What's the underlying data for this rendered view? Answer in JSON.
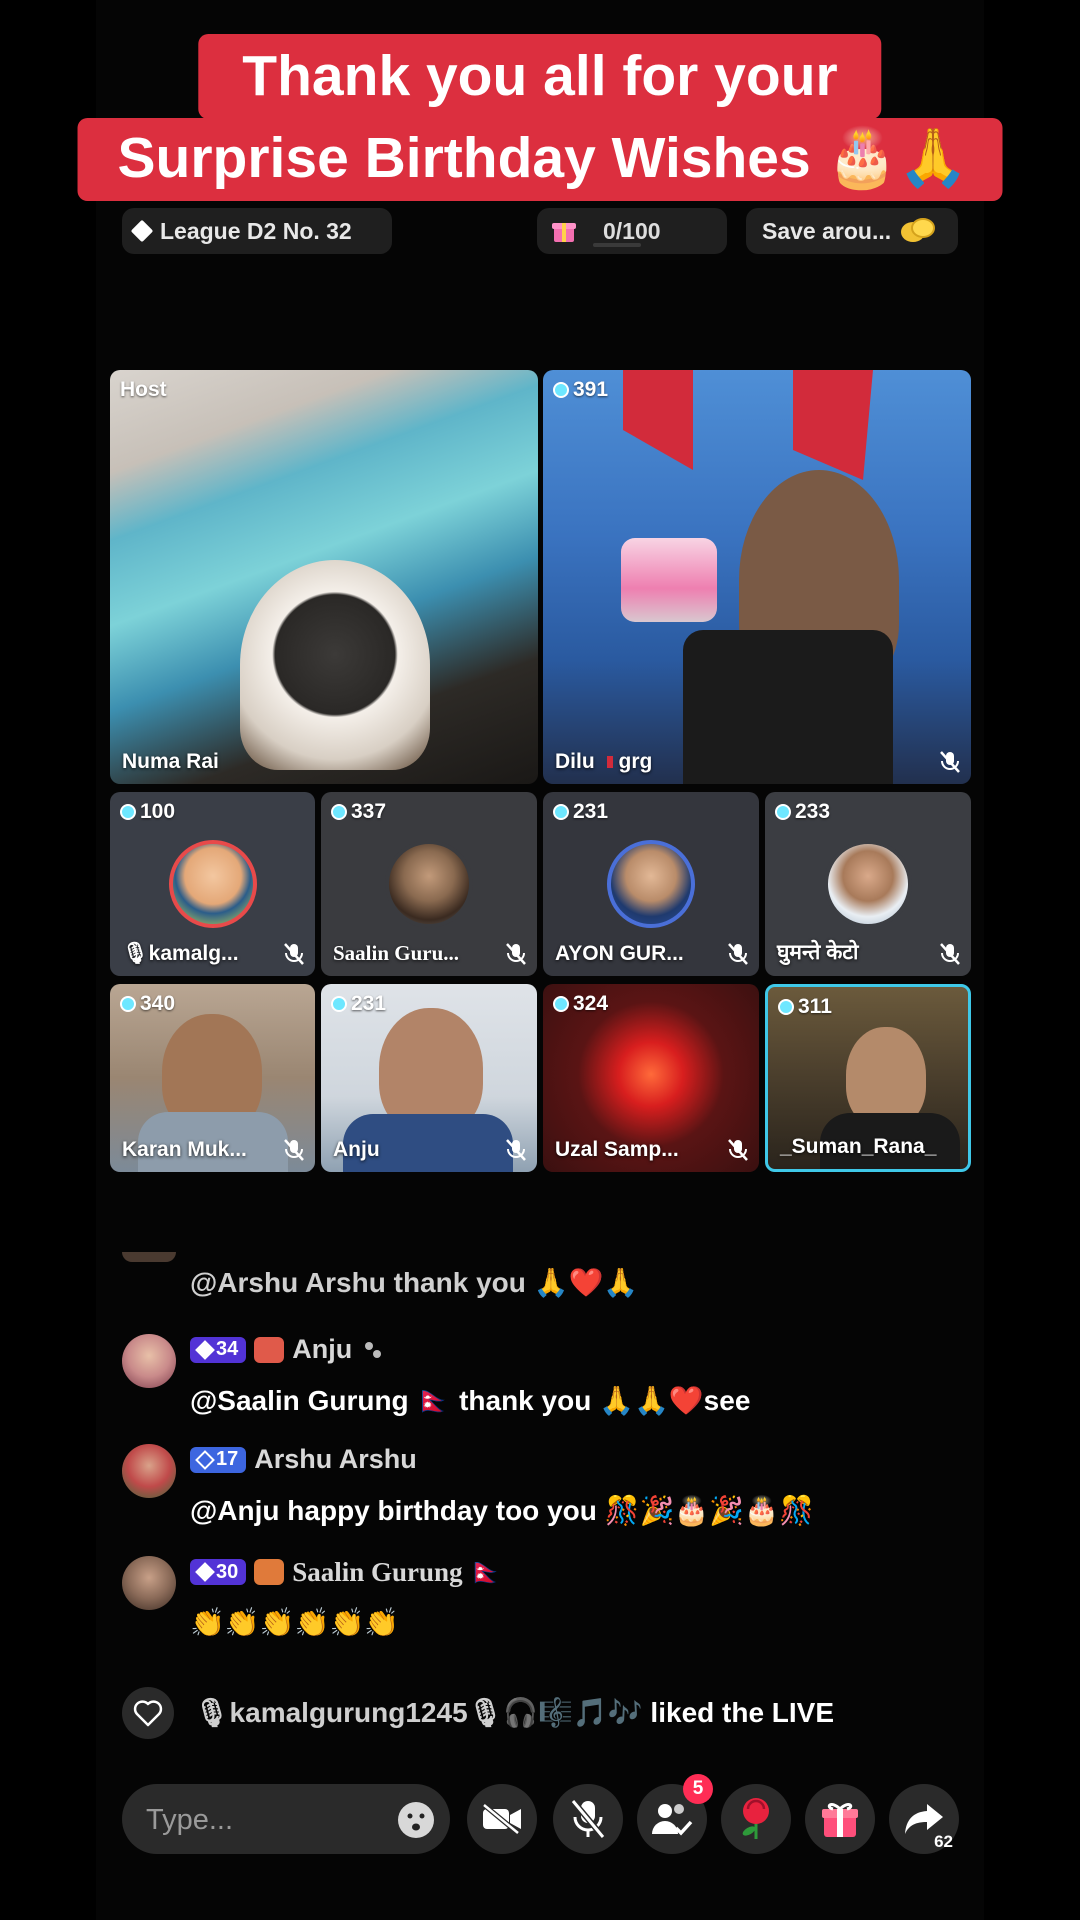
{
  "banner": {
    "line1": "Thank you all for your",
    "line2": "Surprise Birthday Wishes 🎂🙏"
  },
  "top_bar": {
    "league": "League D2 No. 32",
    "progress": "0/100",
    "progress_fraction": 0,
    "save": "Save arou..."
  },
  "grid": {
    "host": {
      "label": "Host",
      "name": "Numa Rai"
    },
    "co_host": {
      "count": "391",
      "name": "Dilu",
      "name_suffix": "grg"
    },
    "row2": [
      {
        "count": "100",
        "name": "🎙kamalg..."
      },
      {
        "count": "337",
        "name": "Saalin Guru..."
      },
      {
        "count": "231",
        "name": "AYON GUR..."
      },
      {
        "count": "233",
        "name": "घुमन्ते केटो"
      }
    ],
    "row3": [
      {
        "count": "340",
        "name": "Karan Muk..."
      },
      {
        "count": "231",
        "name": "Anju"
      },
      {
        "count": "324",
        "name": "Uzal Samp..."
      },
      {
        "count": "311",
        "name": "_Suman_Rana_"
      }
    ]
  },
  "chat": [
    {
      "text": "@Arshu Arshu thank you 🙏❤️🙏"
    },
    {
      "level": "34",
      "user": "Anju",
      "text": "@Saalin Gurung 🇳🇵  thank you 🙏🙏❤️see"
    },
    {
      "level": "17",
      "user": "Arshu Arshu",
      "text": "@Anju happy birthday too you 🎊🎉🎂🎉🎂🎊"
    },
    {
      "level": "30",
      "user": "Saalin Gurung 🇳🇵",
      "text": "👏👏👏👏👏👏"
    }
  ],
  "liked": {
    "user": "🎙kamalgurung1245🎙🎧🎼🎵🎶",
    "text": " liked the LIVE"
  },
  "input": {
    "placeholder": "Type..."
  },
  "buttons": {
    "requests_badge": "5",
    "share_count": "62"
  },
  "colors": {
    "banner": "#dc2f3f",
    "teal_outline": "#3fc8e8"
  }
}
